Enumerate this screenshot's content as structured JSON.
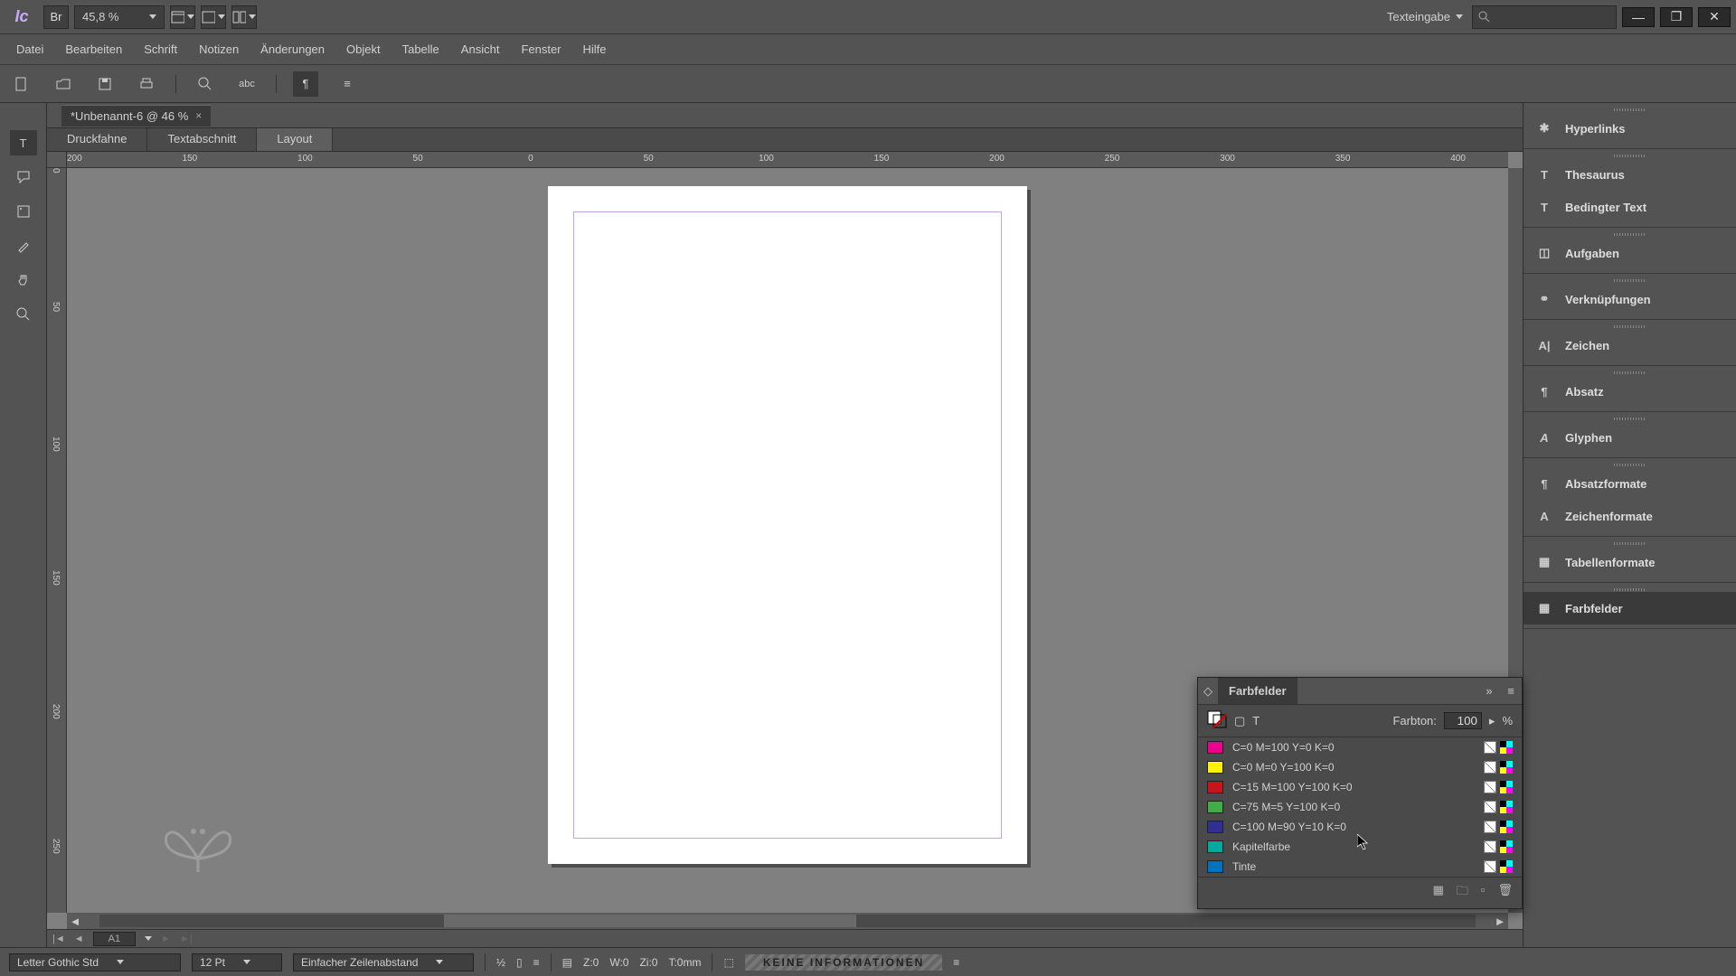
{
  "title_bar": {
    "logo_text": "Ic",
    "br_label": "Br",
    "zoom": "45,8 %",
    "mode": "Texteingabe"
  },
  "menu": [
    "Datei",
    "Bearbeiten",
    "Schrift",
    "Notizen",
    "Änderungen",
    "Objekt",
    "Tabelle",
    "Ansicht",
    "Fenster",
    "Hilfe"
  ],
  "doc_tab": "*Unbenannt-6 @ 46 %",
  "view_tabs": {
    "items": [
      "Druckfahne",
      "Textabschnitt",
      "Layout"
    ],
    "active": 2
  },
  "ruler_h": [
    "200",
    "150",
    "100",
    "50",
    "0",
    "50",
    "100",
    "150",
    "200",
    "250",
    "300",
    "350",
    "400"
  ],
  "ruler_v": [
    "0",
    "50",
    "100",
    "150",
    "200",
    "250"
  ],
  "page_nav": {
    "page": "A1"
  },
  "right_panels": [
    {
      "items": [
        "Hyperlinks"
      ]
    },
    {
      "items": [
        "Thesaurus",
        "Bedingter Text"
      ]
    },
    {
      "items": [
        "Aufgaben"
      ]
    },
    {
      "items": [
        "Verknüpfungen"
      ]
    },
    {
      "items": [
        "Zeichen"
      ]
    },
    {
      "items": [
        "Absatz"
      ]
    },
    {
      "items": [
        "Glyphen"
      ]
    },
    {
      "items": [
        "Absatzformate",
        "Zeichenformate"
      ]
    },
    {
      "items": [
        "Tabellenformate"
      ]
    },
    {
      "items": [
        "Farbfelder"
      ],
      "active": true
    }
  ],
  "swatches": {
    "title": "Farbfelder",
    "tint_label": "Farbton:",
    "tint_value": "100",
    "tint_unit": "%",
    "rows": [
      {
        "name": "C=0 M=100 Y=0 K=0",
        "color": "#ec008c"
      },
      {
        "name": "C=0 M=0 Y=100 K=0",
        "color": "#fff200"
      },
      {
        "name": "C=15 M=100 Y=100 K=0",
        "color": "#c4161c"
      },
      {
        "name": "C=75 M=5 Y=100 K=0",
        "color": "#3fae49"
      },
      {
        "name": "C=100 M=90 Y=10 K=0",
        "color": "#2e3192"
      },
      {
        "name": "Kapitelfarbe",
        "color": "#00a99d"
      },
      {
        "name": "Tinte",
        "color": "#0071bc"
      }
    ]
  },
  "status": {
    "font": "Letter Gothic Std",
    "size": "12 Pt",
    "leading": "Einfacher Zeilenabstand",
    "z": "Z:0",
    "w": "W:0",
    "zi": "Zi:0",
    "t": "T:0mm",
    "info": "KEINE INFORMATIONEN"
  }
}
